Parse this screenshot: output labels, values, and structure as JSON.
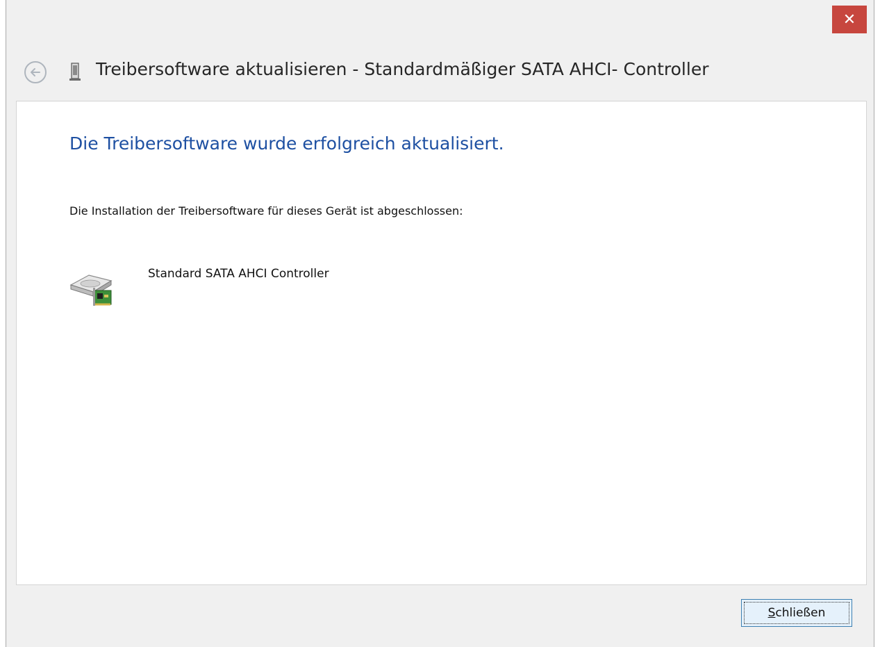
{
  "window": {
    "title": "Treibersoftware aktualisieren - Standardmäßiger SATA AHCI- Controller",
    "close_glyph": "✕",
    "close_color": "#c7463e"
  },
  "content": {
    "heading": "Die Treibersoftware wurde erfolgreich aktualisiert.",
    "heading_color": "#1e50a2",
    "description": "Die Installation der Treibersoftware für dieses Gerät ist abgeschlossen:",
    "device_name": "Standard SATA AHCI Controller",
    "device_icon": "disk-controller-icon"
  },
  "footer": {
    "close_button_mnemonic": "S",
    "close_button_rest": "chließen"
  }
}
